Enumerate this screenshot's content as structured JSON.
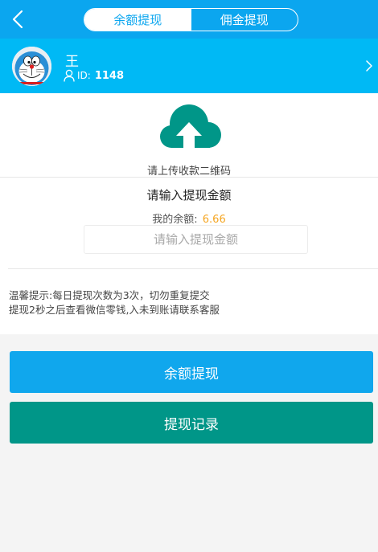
{
  "nav": {
    "tabs": [
      {
        "label": "余额提现",
        "active": true
      },
      {
        "label": "佣金提现",
        "active": false
      }
    ]
  },
  "user": {
    "name": "王",
    "id_label": "ID:",
    "id_value": "1148"
  },
  "upload": {
    "label": "请上传收款二维码"
  },
  "withdraw": {
    "title": "请输入提现金额",
    "balance_label": "我的余额:",
    "balance_value": "6.66",
    "amount_placeholder": "请输入提现金额",
    "amount_value": ""
  },
  "tips": {
    "line1": "温馨提示:每日提现次数为3次，切勿重复提交",
    "line2": "提现2秒之后查看微信零钱,入未到账请联系客服"
  },
  "buttons": {
    "withdraw_label": "余额提现",
    "records_label": "提现记录"
  },
  "colors": {
    "header_blue": "#0ba6ef",
    "user_bar_blue": "#00b9f5",
    "upload_icon_teal": "#009688",
    "balance_orange": "#f5a623",
    "primary_button": "#10a7ed",
    "secondary_button": "#009688"
  },
  "icons": {
    "back": "chevron-left-icon",
    "user": "user-icon",
    "forward": "chevron-right-icon",
    "upload": "cloud-upload-icon",
    "avatar": "doraemon-avatar"
  }
}
